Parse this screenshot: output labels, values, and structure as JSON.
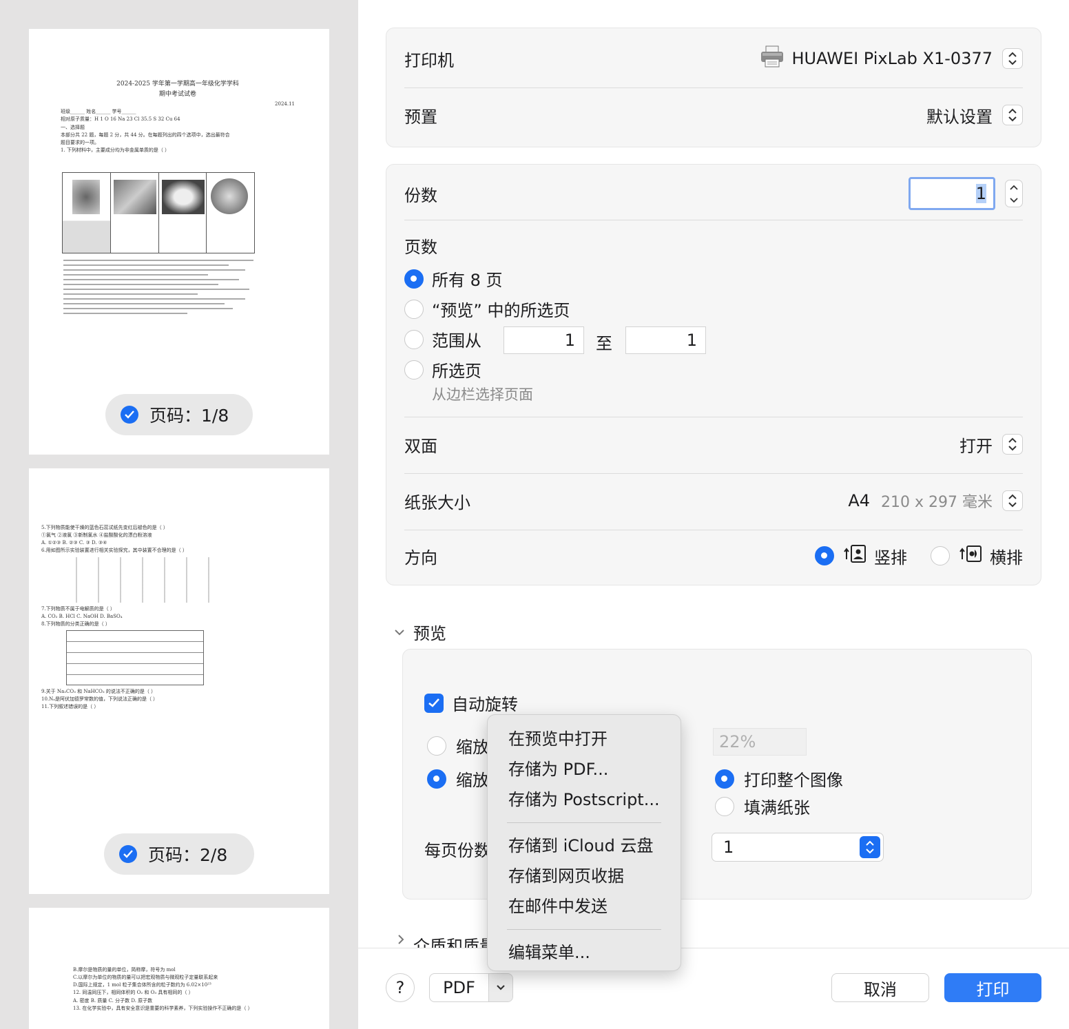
{
  "sidebar": {
    "pages": [
      {
        "badge": "页码：1/8",
        "doc_lines": [
          "2024-2025 学年第一学期高一年级化学学科",
          "期中考试试卷",
          "2024.11",
          "班级______ 姓名______ 学号______",
          "相对原子质量：H 1  O 16  Na 23  Cl 35.5  S 32  Cu 64",
          "一、选择题",
          "本部分共 22 题，每题 2 分，共 44 分。在每题列出的四个选项中，选出最符合",
          "题目要求的一项。",
          "1. 下列材料中，主要成分均为非金属单质的是（ ）"
        ]
      },
      {
        "badge": "页码：2/8",
        "doc_lines": [
          "5.下列物质能使干燥的蓝色石蕊试纸先变红后褪色的是（ ）",
          "①氯气 ②液氯 ③新制氯水 ④盐酸酸化的漂白粉溶液",
          "A. ①②③   B. ②③   C. ③   D. ③④",
          "6.用如图所示实验装置进行相关实验探究，其中装置不合理的是（ ）",
          "7.下列物质不属于电解质的是（ ）",
          "A. CO₂   B. HCl   C. NaOH   D. BaSO₄",
          "8.下列物质的分类正确的是（ ）",
          "9.关于 Na₂CO₃ 和 NaHCO₃ 的说法不正确的是（ ）",
          "10.Nₐ是阿伏加德罗常数的值，下列说法正确的是（ ）",
          "11.下列叙述错误的是（ ）"
        ]
      },
      {
        "doc_lines": [
          "B.摩尔是物质的量的单位，简称摩，符号为 mol",
          "C.以摩尔为单位的物质的量可以把宏观物质与微观粒子定量联系起来",
          "D.国际上规定，1 mol 粒子集合体所含的粒子数约为 6.02×10²³",
          "12. 同温同压下，相同体积的 O₂ 和 O₃ 具有相同的（ ）",
          "A. 密度   B. 质量   C. 分子数   D. 原子数",
          "13. 在化学实验中，具有安全意识是重要的科学素养，下列实验操作不正确的是（ ）"
        ]
      }
    ]
  },
  "printer": {
    "label": "打印机",
    "value": "HUAWEI PixLab X1-0377"
  },
  "preset": {
    "label": "预置",
    "value": "默认设置"
  },
  "copies": {
    "label": "份数",
    "value": "1"
  },
  "pages": {
    "label": "页数",
    "all": "所有 8 页",
    "selection_in_preview": "“预览” 中的所选页",
    "range_from": "范围从",
    "range_to": "至",
    "range_start": "1",
    "range_end": "1",
    "selected": "所选页",
    "selected_hint": "从边栏选择页面"
  },
  "duplex": {
    "label": "双面",
    "value": "打开"
  },
  "paper": {
    "label": "纸张大小",
    "size": "A4",
    "dims": "210 x 297 毫米"
  },
  "orientation": {
    "label": "方向",
    "portrait": "竖排",
    "landscape": "横排"
  },
  "preview": {
    "section": "预览",
    "auto_rotate": "自动旋转",
    "scale": "缩放",
    "scale_fit": "缩放",
    "scale_value": "22%",
    "print_entire": "打印整个图像",
    "fill_paper": "填满纸张",
    "copies_per_page": "每页份数",
    "copies_per_page_value": "1"
  },
  "media_section": "介质和质量",
  "pdf_menu": {
    "items": [
      "在预览中打开",
      "存储为 PDF...",
      "存储为 Postscript..."
    ],
    "items2": [
      "存储到 iCloud 云盘",
      "存储到网页收据",
      "在邮件中发送"
    ],
    "items3": [
      "编辑菜单..."
    ]
  },
  "footer": {
    "help": "?",
    "pdf": "PDF",
    "cancel": "取消",
    "print": "打印"
  },
  "colors": {
    "accent": "#1b6ef3",
    "panel": "#f6f6f6",
    "sidebar": "#e4e3e3"
  }
}
